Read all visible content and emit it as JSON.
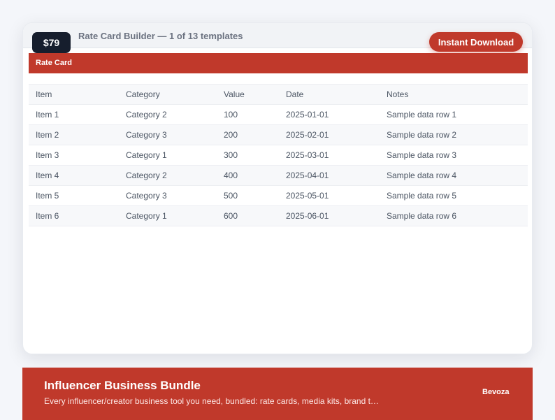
{
  "product": {
    "price": "$79",
    "title": "Rate Card Builder — 1 of 13 templates",
    "download_label": "Instant Download"
  },
  "sheet": {
    "title": "Rate Card",
    "columns": [
      "Item",
      "Category",
      "Value",
      "Date",
      "Notes"
    ],
    "rows": [
      [
        "Item 1",
        "Category 2",
        "100",
        "2025-01-01",
        "Sample data row 1"
      ],
      [
        "Item 2",
        "Category 3",
        "200",
        "2025-02-01",
        "Sample data row 2"
      ],
      [
        "Item 3",
        "Category 1",
        "300",
        "2025-03-01",
        "Sample data row 3"
      ],
      [
        "Item 4",
        "Category 2",
        "400",
        "2025-04-01",
        "Sample data row 4"
      ],
      [
        "Item 5",
        "Category 3",
        "500",
        "2025-05-01",
        "Sample data row 5"
      ],
      [
        "Item 6",
        "Category 1",
        "600",
        "2025-06-01",
        "Sample data row 6"
      ]
    ]
  },
  "bundle": {
    "title": "Influencer Business Bundle",
    "description": "Every influencer/creator business tool you need, bundled: rate cards, media kits, brand t…",
    "brand": "Bevoza"
  },
  "colors": {
    "accent": "#c0392b",
    "badge": "#161e2d",
    "background": "#f4f6fa"
  }
}
